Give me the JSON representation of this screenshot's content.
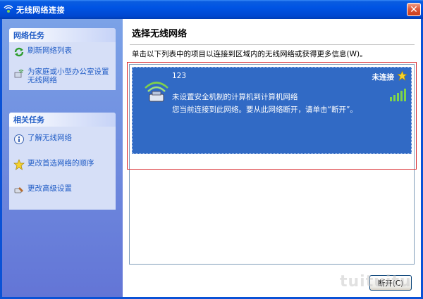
{
  "window": {
    "title": "无线网络连接",
    "close_label": "✕"
  },
  "sidebar": {
    "network_tasks": {
      "header": "网络任务",
      "items": [
        {
          "label": "刷新网络列表",
          "icon": "refresh-icon"
        },
        {
          "label": "为家庭或小型办公室设置无线网络",
          "icon": "setup-wizard-icon"
        }
      ]
    },
    "related_tasks": {
      "header": "相关任务",
      "items": [
        {
          "label": "了解无线网络",
          "icon": "info-icon"
        },
        {
          "label": "更改首选网络的顺序",
          "icon": "star-icon"
        },
        {
          "label": "更改高级设置",
          "icon": "settings-icon"
        }
      ]
    }
  },
  "main": {
    "heading": "选择无线网络",
    "instruction": "单击以下列表中的项目以连接到区域内的无线网络或获得更多信息(W)。",
    "networks": [
      {
        "ssid": "123",
        "status": "未连接",
        "description": "未设置安全机制的计算机到计算机网络",
        "note": "您当前连接到此网络。要从此网络断开，请单击“断开”。",
        "selected": true,
        "preferred": true,
        "signal_bars": 5
      }
    ],
    "disconnect_button": "断开(C)"
  },
  "watermark": "tuituitu",
  "colors": {
    "title_bar": "#0054e3",
    "selection": "#316ac5",
    "task_link": "#215dc6",
    "highlight_box": "#d8282c"
  }
}
